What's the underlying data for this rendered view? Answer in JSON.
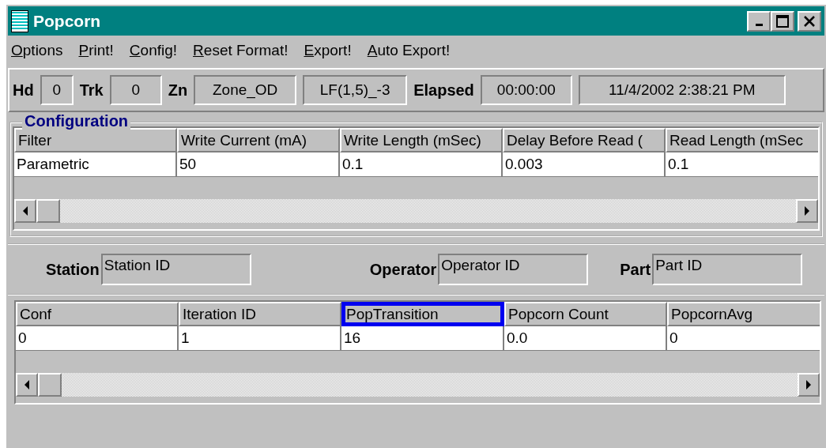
{
  "window": {
    "title": "Popcorn"
  },
  "menu": [
    "Options",
    "Print!",
    "Config!",
    "Reset Format!",
    "Export!",
    "Auto Export!"
  ],
  "info_bar": [
    {
      "kind": "label",
      "text": "Hd"
    },
    {
      "kind": "field",
      "text": "0"
    },
    {
      "kind": "label",
      "text": "Trk"
    },
    {
      "kind": "field",
      "text": "0"
    },
    {
      "kind": "label",
      "text": "Zn"
    },
    {
      "kind": "field",
      "text": "Zone_OD"
    },
    {
      "kind": "field",
      "text": "LF(1,5)_-3"
    },
    {
      "kind": "label",
      "text": "Elapsed"
    },
    {
      "kind": "field",
      "text": "00:00:00"
    },
    {
      "kind": "field",
      "text": "11/4/2002 2:38:21 PM"
    }
  ],
  "configuration": {
    "title": "Configuration",
    "columns": [
      {
        "label": "Filter",
        "highlighted": false
      },
      {
        "label": "Write Current (mA)",
        "highlighted": false
      },
      {
        "label": "Write Length (mSec)",
        "highlighted": false
      },
      {
        "label": "Delay Before Read (",
        "highlighted": false
      },
      {
        "label": "Read Length (mSec",
        "highlighted": false
      }
    ],
    "rows": [
      [
        "Parametric",
        "50",
        "0.1",
        "0.003",
        "0.1"
      ]
    ]
  },
  "ids": [
    {
      "label": "Station",
      "value": "Station ID"
    },
    {
      "label": "Operator",
      "value": "Operator ID"
    },
    {
      "label": "Part",
      "value": "Part ID"
    }
  ],
  "results": {
    "columns": [
      {
        "label": "Conf",
        "highlighted": false
      },
      {
        "label": "Iteration ID",
        "highlighted": false
      },
      {
        "label": "PopTransition",
        "highlighted": true
      },
      {
        "label": "Popcorn Count",
        "highlighted": false
      },
      {
        "label": "PopcornAvg",
        "highlighted": false
      }
    ],
    "rows": [
      [
        "0",
        "1",
        "16",
        "0.0",
        "0"
      ]
    ]
  }
}
